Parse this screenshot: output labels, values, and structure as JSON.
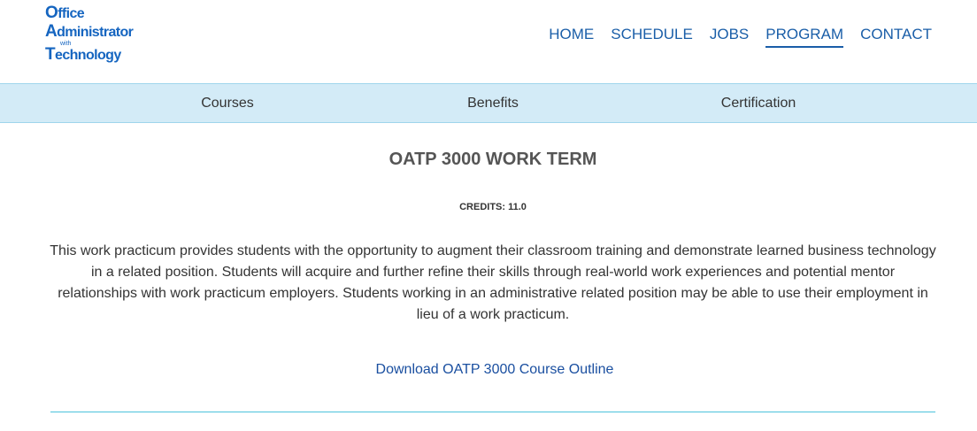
{
  "logo": {
    "line1_cap": "O",
    "line1_rest": "ffice",
    "line2_cap": "A",
    "line2_rest": "dministrator",
    "line3": "with",
    "line4_cap": "T",
    "line4_rest": "echnology"
  },
  "nav": [
    {
      "label": "HOME"
    },
    {
      "label": "SCHEDULE"
    },
    {
      "label": "JOBS"
    },
    {
      "label": "PROGRAM",
      "active": true
    },
    {
      "label": "CONTACT"
    }
  ],
  "subnav": [
    {
      "label": "Courses"
    },
    {
      "label": "Benefits"
    },
    {
      "label": "Certification"
    }
  ],
  "course": {
    "title": "OATP 3000 WORK TERM",
    "credits": "CREDITS: 11.0",
    "description": "This work practicum provides students with the opportunity to augment their classroom training and demonstrate learned business technology in a related position. Students will acquire and further refine their skills through real-world work experiences and potential mentor relationships with work practicum employers. Students working in an administrative related position may be able to use their employment in lieu of a work practicum.",
    "download_label": "Download OATP 3000 Course Outline"
  },
  "colors": {
    "brand": "#1565c0",
    "nav_link": "#1a5ea8",
    "subnav_bg": "#d3ebf7",
    "rule": "#4cc3dc"
  }
}
